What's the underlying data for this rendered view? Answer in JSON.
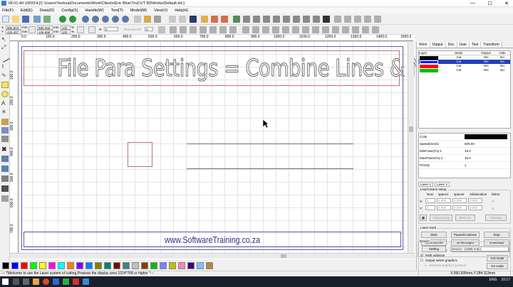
{
  "window": {
    "title": "V8.01.40-190314-[C:\\Users\\Yeshua\\Documents\\Work\\Clients\\Eric Blue\\TruCUT RDWorks\\Default.rld-]",
    "controls": [
      "—",
      "☐",
      "✕"
    ]
  },
  "menu": [
    "File(F)",
    "Edit(E)",
    "Draw(D)",
    "Config(S)",
    "Handle(W)",
    "Tool(T)",
    "Model(M)",
    "View(V)",
    "Help(H)"
  ],
  "toolbar": {
    "x_value": "969.904",
    "x_unit": "mm",
    "y_value": "426.307",
    "y_unit": "mm",
    "w_value": "889.055",
    "w_unit": "mm",
    "h_value": "106.658",
    "h_unit": "mm",
    "sx_value": "100",
    "sx_unit": "%",
    "sy_value": "100",
    "sy_unit": "%",
    "rotate_value": "0",
    "process_no": "Process NO",
    "process_val": "0"
  },
  "ruler_top": [
    "0.0",
    "100.0",
    "200.0",
    "300.0",
    "400.0",
    "500.0",
    "600.0",
    "700.0",
    "800.0",
    "900.0",
    "1000.0",
    "1100.0",
    "1200.0",
    "1300.0",
    "1400.0",
    "1500.0"
  ],
  "ruler_left": [
    "100.0",
    "200.0",
    "300.0",
    "400.0",
    "500.0",
    "600.0",
    "700.0"
  ],
  "canvas": {
    "title": "File Para Settings = Combine Lines & Nodes",
    "footer": "www.SoftwareTraining.co.za"
  },
  "palette": [
    "#000000",
    "#0000ff",
    "#ff0000",
    "#00ff00",
    "#ffff00",
    "#ff00ff",
    "#00ffff",
    "#ff8000",
    "#8000ff",
    "#0080ff",
    "#808000",
    "#008080",
    "#800000",
    "#408080",
    "#c0c0c0",
    "#804000",
    "#00c000",
    "#8080ff",
    "#c0c000",
    "#ff80c0",
    "#400080",
    "#80c0ff",
    "#c08040"
  ],
  "status": {
    "message": "--- *Welcome to use the Laser system of cutting,Propose the display area 1024*768 or higher *---",
    "coords": "X:950.595mm,Y:284.113mm"
  },
  "panel": {
    "tabs": [
      "Work",
      "Output",
      "Doc",
      "User",
      "Test",
      "Transform"
    ],
    "layer_headers": [
      "Layer",
      "Mode",
      "Output",
      "Hide"
    ],
    "layers": [
      {
        "color": "#000000",
        "mode": "Cut",
        "output": "Yes",
        "hide": "No"
      },
      {
        "color": "#0000ff",
        "mode": "Cut",
        "output": "Yes",
        "hide": "No"
      },
      {
        "color": "#ff0000",
        "mode": "Cut",
        "output": "Yes",
        "hide": "No"
      },
      {
        "color": "#00c000",
        "mode": "Cut",
        "output": "Yes",
        "hide": "No"
      }
    ],
    "props": [
      {
        "k": "Color",
        "v": ""
      },
      {
        "k": "Speed(mm/s)",
        "v": "600.00"
      },
      {
        "k": "MinPower(%)-1",
        "v": "15.0"
      },
      {
        "k": "MaxPower(%)-1",
        "v": "15.0"
      },
      {
        "k": "Priority",
        "v": "1"
      }
    ],
    "subtabs": [
      "Laser 1",
      "Laser 2"
    ],
    "array": {
      "title": "Line/column setup",
      "headers": [
        "Num",
        "space1",
        "space2",
        "Xdislocation",
        "Mirror"
      ],
      "x_label": "X:",
      "y_label": "Y:",
      "x_vals": [
        "1",
        "0.000",
        "0.000",
        "0.000"
      ],
      "y_vals": [
        "1",
        "0.000",
        "0.000",
        "0.000"
      ],
      "mirror": "H",
      "virtual": "Virtual array",
      "bestres": "Best res",
      "nesting": "Nesting"
    },
    "laserwork": {
      "title": "Laser work",
      "start": "Start",
      "pause": "Pause/Continue",
      "stop": "Stop",
      "save": "SaveToUFile",
      "ufile": "UFileOutput",
      "download": "Download",
      "position_label": "Position:",
      "position_value": "Current position",
      "path_opt": "Path optimize",
      "output_sel": "Output select graphics",
      "selected": "Selected graphics position",
      "cut_scale": "Cut scale",
      "go_scale": "Go scale"
    },
    "device": {
      "title": "Device",
      "setting": "Setting",
      "value": "Device---(USB:Auto)"
    }
  },
  "taskbar": {
    "lang": "ENG",
    "time": "10:17"
  }
}
